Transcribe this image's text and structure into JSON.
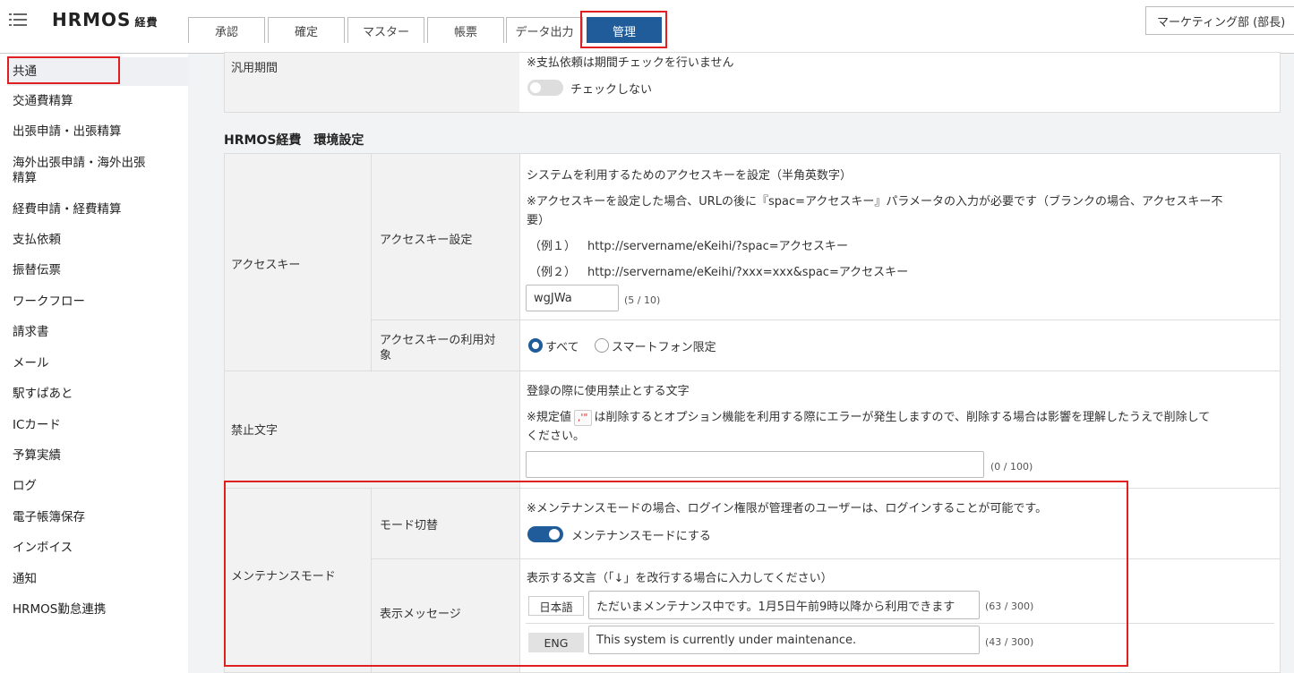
{
  "header": {
    "logo_text": "HRMOS",
    "logo_suffix": "経費",
    "tabs": [
      {
        "label": "承認"
      },
      {
        "label": "確定"
      },
      {
        "label": "マスター"
      },
      {
        "label": "帳票"
      },
      {
        "label": "データ出力"
      },
      {
        "label": "管理"
      }
    ],
    "active_tab": "管理",
    "department": "マーケティング部 (部長)"
  },
  "sidebar": {
    "items": [
      {
        "label": "共通"
      },
      {
        "label": "交通費精算"
      },
      {
        "label": "出張申請・出張精算"
      },
      {
        "label": "海外出張申請・海外出張"
      },
      {
        "label": "精算"
      },
      {
        "label": "経費申請・経費精算"
      },
      {
        "label": "支払依頼"
      },
      {
        "label": "振替伝票"
      },
      {
        "label": "ワークフロー"
      },
      {
        "label": "請求書"
      },
      {
        "label": "メール"
      },
      {
        "label": "駅すぱあと"
      },
      {
        "label": "ICカード"
      },
      {
        "label": "予算実績"
      },
      {
        "label": "ログ"
      },
      {
        "label": "電子帳簿保存"
      },
      {
        "label": "インボイス"
      },
      {
        "label": "通知"
      },
      {
        "label": "HRMOS勤怠連携"
      }
    ],
    "active_item": "共通"
  },
  "main": {
    "general_period": {
      "label": "汎用期間",
      "note": "※支払依頼は期間チェックを行いません",
      "toggle_label": "チェックしない",
      "toggle_on": false
    },
    "section_title": "HRMOS経費　環境設定",
    "access_key": {
      "group_label": "アクセスキー",
      "setting_label": "アクセスキー設定",
      "desc1": "システムを利用するためのアクセスキーを設定（半角英数字）",
      "desc2a": "※アクセスキーを設定した場合、URLの後に『spac=アクセスキー』パラメータの入力が必要です（ブランクの場合、アクセスキー不",
      "desc2b": "要）",
      "ex1_label": "（例１）",
      "ex1_url": "http://servername/eKeihi/?spac=アクセスキー",
      "ex2_label": "（例２）",
      "ex2_url": "http://servername/eKeihi/?xxx=xxx&spac=アクセスキー",
      "value": "wgJWa",
      "counter": "(5 / 10)",
      "target_label_1": "アクセスキーの利用対",
      "target_label_2": "象",
      "option_all": "すべて",
      "option_smartphone": "スマートフォン限定",
      "selected_option": "すべて"
    },
    "forbidden": {
      "label": "禁止文字",
      "desc": "登録の際に使用禁止とする文字",
      "note_prefix": "※規定値",
      "note_chip": ",'\"",
      "note_suffix_a": "は削除するとオプション機能を利用する際にエラーが発生しますので、削除する場合は影響を理解したうえで削除して",
      "note_suffix_b": "ください。",
      "value": "",
      "counter": "(0 / 100)"
    },
    "maintenance": {
      "group_label": "メンテナンスモード",
      "mode_label": "モード切替",
      "mode_note": "※メンテナンスモードの場合、ログイン権限が管理者のユーザーは、ログインすることが可能です。",
      "toggle_label": "メンテナンスモードにする",
      "toggle_on": true,
      "message_label": "表示メッセージ",
      "message_desc": "表示する文言（「↓」を改行する場合に入力してください）",
      "jp_label": "日本語",
      "jp_value": "ただいまメンテナンス中です。1月5日午前9時以降から利用できます",
      "jp_counter": "(63 / 300)",
      "en_label": "ENG",
      "en_value": "This system is currently under maintenance.",
      "en_counter": "(43 / 300)"
    }
  }
}
